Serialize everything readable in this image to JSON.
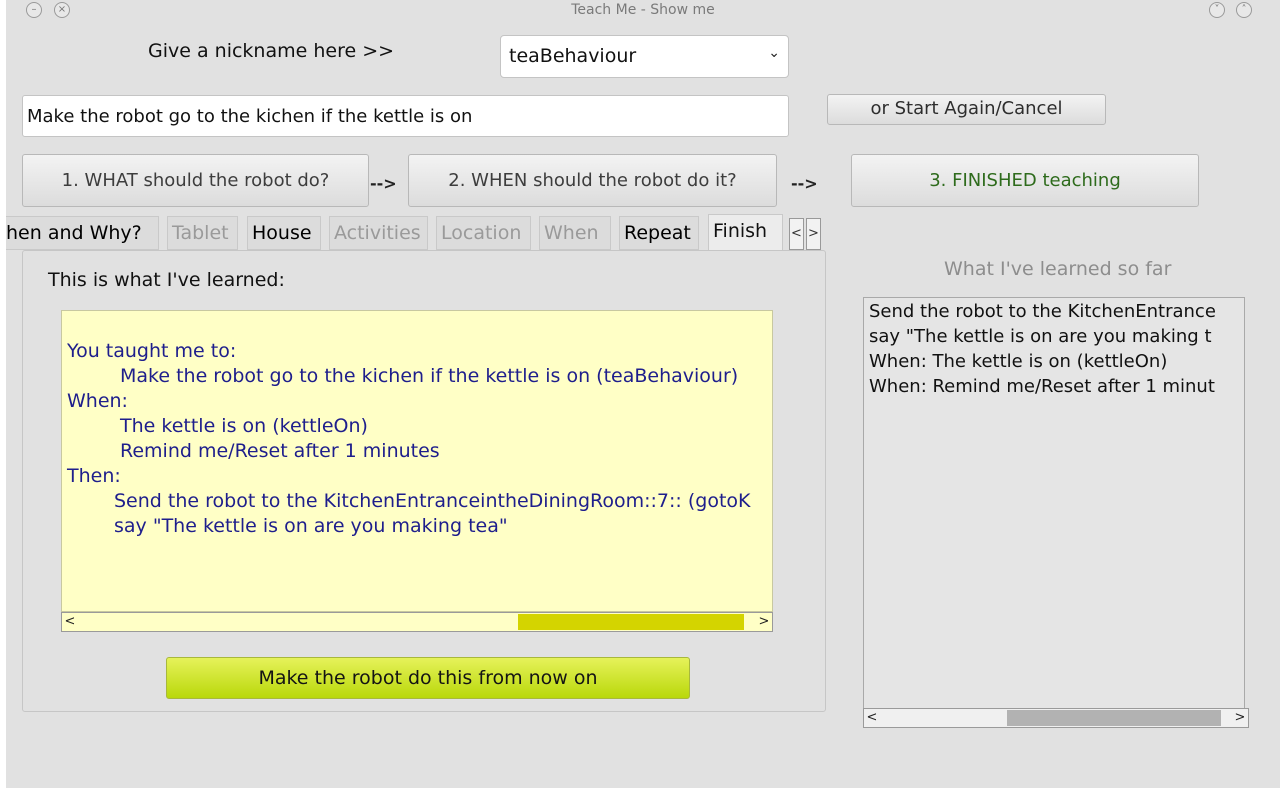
{
  "window": {
    "title": "Teach Me - Show me"
  },
  "nickname": {
    "label": "Give a nickname here >>",
    "selected": "teaBehaviour"
  },
  "description": {
    "value": "Make the robot go to the kichen if the kettle is on"
  },
  "buttons": {
    "restart": "or Start Again/Cancel",
    "step1": "1. WHAT should the robot do?",
    "arrow1": "-->",
    "step2": "2. WHEN should the robot do it?",
    "arrow2": "-->",
    "step3": "3. FINISHED teaching",
    "make": "Make the robot do this from now on"
  },
  "tabs": [
    {
      "label": "hen and Why?",
      "state": "enabled"
    },
    {
      "label": "Tablet",
      "state": "disabled"
    },
    {
      "label": "House",
      "state": "enabled"
    },
    {
      "label": "Activities",
      "state": "disabled"
    },
    {
      "label": "Location",
      "state": "disabled"
    },
    {
      "label": "When",
      "state": "disabled"
    },
    {
      "label": "Repeat",
      "state": "enabled"
    },
    {
      "label": "Finish",
      "state": "active"
    }
  ],
  "tab_scroll": {
    "left": "<",
    "right": ">"
  },
  "main": {
    "heading": "This is what I've learned:",
    "summary_lines": [
      "You taught me to:",
      "Make the robot go to the kichen if the kettle is on (teaBehaviour)",
      "When:",
      "The kettle is on (kettleOn)",
      "Remind me/Reset after 1 minutes",
      "Then:",
      "Send the robot to the KitchenEntranceintheDiningRoom::7:: (gotoK",
      "say \"The kettle is on  are you making tea\""
    ],
    "scroll_arrows": {
      "left": "<",
      "right": ">"
    }
  },
  "side": {
    "heading": "What I've learned so far",
    "lines": [
      "Send the robot to the KitchenEntrance",
      "say \"The kettle is on  are you making t",
      "When: The kettle is on (kettleOn)",
      "When: Remind me/Reset after 1 minut"
    ],
    "scroll_arrows": {
      "left": "<",
      "right": ">"
    }
  },
  "colors": {
    "summary_bg": "#ffffc6",
    "summary_text": "#1e1e8c",
    "make_button": "#c8e020",
    "finished_text": "#2e6b1c"
  }
}
